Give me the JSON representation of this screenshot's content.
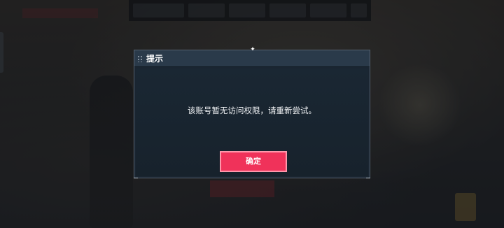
{
  "dialog": {
    "title": "提示",
    "message": "该账号暂无访问权限，请重新尝试。",
    "confirm_label": "确定"
  },
  "colors": {
    "confirm_button": "#f0325a",
    "dialog_background": "#1a2531",
    "dialog_header": "#2a3a4a"
  },
  "icons": {
    "pin": "pin-icon",
    "drag": "drag-handle-icon"
  }
}
